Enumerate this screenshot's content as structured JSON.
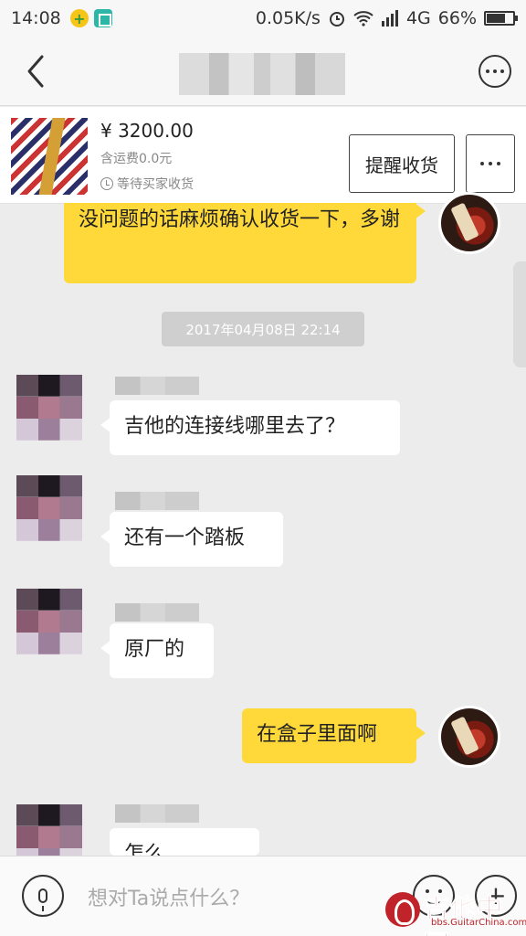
{
  "status_bar": {
    "time": "14:08",
    "network_speed": "0.05K/s",
    "network_type": "4G",
    "battery_percent": "66%",
    "icons": [
      "plus-circle-icon",
      "scan-icon",
      "alarm-icon",
      "wifi-icon",
      "signal-icon",
      "battery-icon"
    ]
  },
  "nav": {
    "back_icon": "chevron-left-icon",
    "more_icon": "more-circle-icon"
  },
  "order": {
    "price": "¥ 3200.00",
    "freight": "含运费0.0元",
    "status": "等待买家收货",
    "remind_button": "提醒收货",
    "more_icon": "more-dots-icon"
  },
  "messages": [
    {
      "side": "out",
      "text": "没问题的话麻烦确认收货一下，多谢"
    },
    {
      "type": "timestamp",
      "text": "2017年04月08日 22:14"
    },
    {
      "side": "in",
      "text": "吉他的连接线哪里去了？"
    },
    {
      "side": "in",
      "text": "还有一个踏板"
    },
    {
      "side": "in",
      "text": "原厂的"
    },
    {
      "side": "out",
      "text": "在盒子里面啊"
    },
    {
      "side": "in",
      "text": "怎么"
    }
  ],
  "input": {
    "placeholder": "想对Ta说点什么？",
    "mic_icon": "microphone-icon",
    "emoji_icon": "emoji-icon",
    "plus_icon": "plus-icon"
  },
  "watermark": {
    "text": "吉他中国",
    "sub": "bbs.GuitarChina.com"
  },
  "colors": {
    "outgoing_bubble": "#ffd93a",
    "incoming_bubble": "#ffffff",
    "background": "#ececec"
  }
}
